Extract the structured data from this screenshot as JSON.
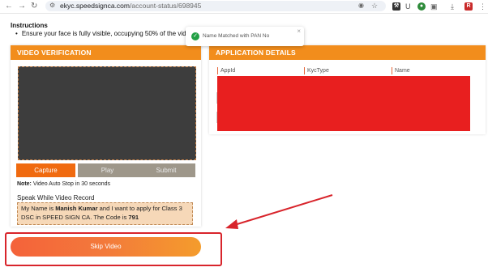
{
  "browser": {
    "url_host": "ekyc.speedsignca.com",
    "url_path": "/account-status/698945",
    "extensions": [
      {
        "icon": "translate-icon",
        "label": "G"
      },
      {
        "icon": "star-icon",
        "label": "★"
      },
      {
        "icon": "puzzle-icon",
        "label": "U"
      },
      {
        "icon": "download-icon",
        "label": "⤓"
      }
    ]
  },
  "instructions": {
    "title": "Instructions",
    "item": "Ensure your face is fully visible, occupying 50% of the video fr"
  },
  "toast": {
    "message": "Name Matched with PAN No",
    "close": "×"
  },
  "video_card": {
    "title": "VIDEO VERIFICATION",
    "buttons": {
      "capture": "Capture",
      "play": "Play",
      "submit": "Submit"
    },
    "note_label": "Note:",
    "note_text": " Video Auto Stop in 30 seconds",
    "speak_title": "Speak While Video Record",
    "speak_prefix": "My Name is ",
    "speak_name": "Manish Kumar",
    "speak_middle": " and I want to apply for Class 3 DSC in SPEED SIGN CA. The Code is ",
    "speak_code": "791"
  },
  "app_card": {
    "title": "APPLICATION DETAILS",
    "columns": [
      "AppId",
      "KycType",
      "Name"
    ]
  },
  "skip_button": "Skip Video",
  "colors": {
    "header_orange": "#f28d1c",
    "capture_orange": "#f06a0f",
    "disabled_gray": "#9e978a",
    "redaction_red": "#e81f1f",
    "highlight_red": "#d8242b"
  }
}
